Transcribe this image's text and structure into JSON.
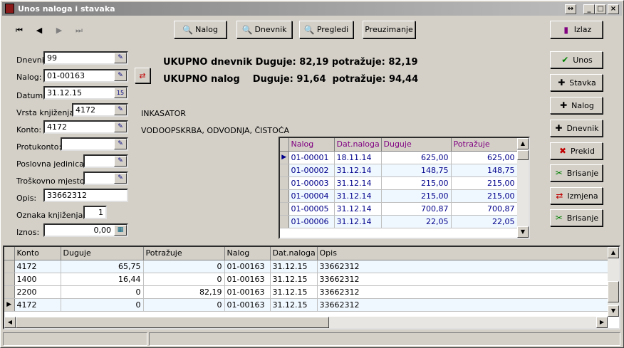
{
  "window": {
    "title": "Unos naloga i stavaka",
    "controls": [
      "↔",
      "_",
      "□",
      "×"
    ]
  },
  "nav": [
    "⏮",
    "◀",
    "▶",
    "⏭"
  ],
  "toolbar": {
    "nalog": "Nalog",
    "dnevnik": "Dnevnik",
    "pregledi": "Pregledi",
    "preuzimanje": "Preuzimanje",
    "izlaz": "Izlaz"
  },
  "form": {
    "dnevnik_label": "Dnevnik",
    "dnevnik": "99",
    "nalog_label": "Nalog:",
    "nalog": "01-00163",
    "datum_label": "Datum:",
    "datum": "31.12.15",
    "vrsta_label": "Vrsta knjiženja:",
    "vrsta": "4172",
    "vrsta_desc": "INKASATOR",
    "konto_label": "Konto:",
    "konto": "4172",
    "konto_desc": "VODOOPSKRBA, ODVODNJA, ČISTOĆA",
    "protukonto_label": "Protukonto:",
    "protukonto": "",
    "posl_label": "Poslovna jedinica:",
    "posl": "",
    "tros_label": "Troškovno mjesto:",
    "tros": "",
    "opis_label": "Opis:",
    "opis": "33662312",
    "oznaka_label": "Oznaka knjiženja:",
    "oznaka": "1",
    "iznos_label": "Iznos:",
    "iznos": "0,00"
  },
  "totals": {
    "dnevnik": "UKUPNO dnevnik Duguje: 82,19  potražuje: 82,19",
    "nalog": "UKUPNO nalog    Duguje: 91,64  potražuje: 94,44"
  },
  "side": {
    "unos": "Unos",
    "stavka": "Stavka",
    "nalog": "Nalog",
    "dnevnik": "Dnevnik",
    "prekid": "Prekid",
    "brisanje1": "Brisanje",
    "izmjena": "Izmjena",
    "brisanje2": "Brisanje"
  },
  "nalozi": {
    "headers": [
      "Nalog",
      "Dat.naloga",
      "Duguje",
      "Potražuje"
    ],
    "rows": [
      [
        "01-00001",
        "18.11.14",
        "625,00",
        "625,00"
      ],
      [
        "01-00002",
        "31.12.14",
        "148,75",
        "148,75"
      ],
      [
        "01-00003",
        "31.12.14",
        "215,00",
        "215,00"
      ],
      [
        "01-00004",
        "31.12.14",
        "215,00",
        "215,00"
      ],
      [
        "01-00005",
        "31.12.14",
        "700,87",
        "700,87"
      ],
      [
        "01-00006",
        "31.12.14",
        "22,05",
        "22,05"
      ]
    ]
  },
  "stavke": {
    "headers": [
      "Konto",
      "Duguje",
      "Potražuje",
      "Nalog",
      "Dat.naloga",
      "Opis"
    ],
    "rows": [
      [
        "4172",
        "65,75",
        "0",
        "01-00163",
        "31.12.15",
        "33662312"
      ],
      [
        "1400",
        "16,44",
        "0",
        "01-00163",
        "31.12.15",
        "33662312"
      ],
      [
        "2200",
        "0",
        "82,19",
        "01-00163",
        "31.12.15",
        "33662312"
      ],
      [
        "4172",
        "0",
        "0",
        "01-00163",
        "31.12.15",
        "33662312"
      ]
    ]
  }
}
